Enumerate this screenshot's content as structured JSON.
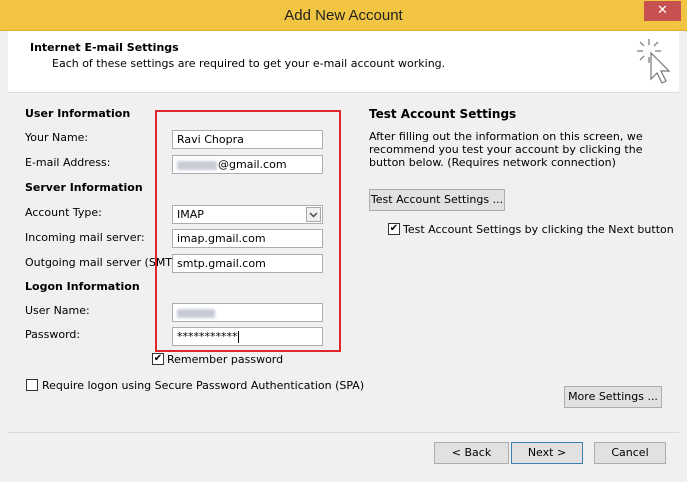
{
  "window": {
    "title": "Add New Account",
    "close_glyph": "✕"
  },
  "header": {
    "title": "Internet E-mail Settings",
    "subtitle": "Each of these settings are required to get your e-mail account working."
  },
  "user_info": {
    "heading": "User Information",
    "name_label": "Your Name:",
    "name_value": "Ravi Chopra",
    "email_label": "E-mail Address:",
    "email_value": "@gmail.com"
  },
  "server_info": {
    "heading": "Server Information",
    "account_type_label": "Account Type:",
    "account_type_value": "IMAP",
    "incoming_label": "Incoming mail server:",
    "incoming_value": "imap.gmail.com",
    "outgoing_label": "Outgoing mail server (SMTP):",
    "outgoing_value": "smtp.gmail.com"
  },
  "logon_info": {
    "heading": "Logon Information",
    "username_label": "User Name:",
    "password_label": "Password:",
    "password_value": "***********",
    "remember_label": "Remember password",
    "remember_checked": true,
    "spa_label": "Require logon using Secure Password Authentication (SPA)",
    "spa_checked": false
  },
  "test_settings": {
    "heading": "Test Account Settings",
    "description": "After filling out the information on this screen, we recommend you test your account by clicking the button below. (Requires network connection)",
    "test_button": "Test Account Settings ...",
    "auto_test_label": "Test Account Settings by clicking the Next button",
    "auto_test_checked": true
  },
  "buttons": {
    "more_settings": "More Settings ...",
    "back": "< Back",
    "next": "Next >",
    "cancel": "Cancel"
  },
  "icons": {
    "wand": "wand-cursor-icon",
    "checkmark": "✔",
    "dropdown": "chevron-down-icon"
  },
  "colors": {
    "titlebar": "#f1c542",
    "highlight_box": "#e0262a",
    "close_button": "#c75050"
  }
}
